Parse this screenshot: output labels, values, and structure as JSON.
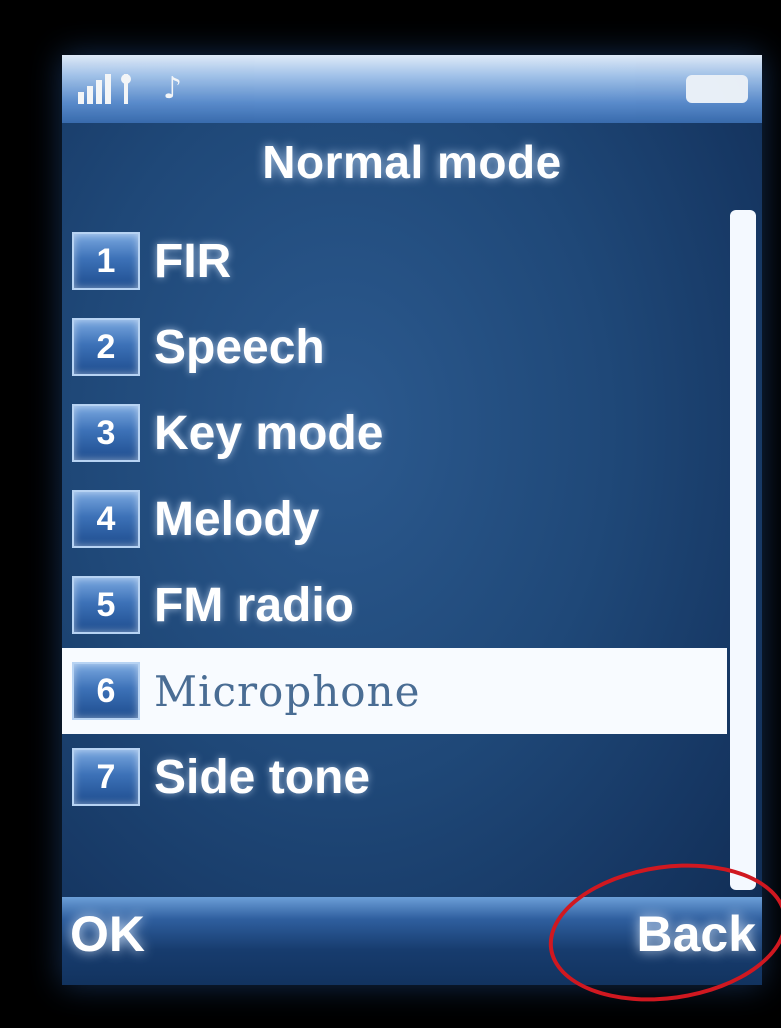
{
  "status": {
    "icons": [
      "signal-icon",
      "antenna-icon",
      "music-note-icon",
      "battery-icon"
    ],
    "note_glyph": "♪"
  },
  "title": "Normal mode",
  "menu": {
    "items": [
      {
        "num": "1",
        "label": "FIR"
      },
      {
        "num": "2",
        "label": "Speech"
      },
      {
        "num": "3",
        "label": "Key mode"
      },
      {
        "num": "4",
        "label": "Melody"
      },
      {
        "num": "5",
        "label": "FM radio"
      },
      {
        "num": "6",
        "label": "Microphone",
        "selected": true
      },
      {
        "num": "7",
        "label": "Side tone"
      }
    ]
  },
  "softkeys": {
    "left": "OK",
    "right": "Back"
  },
  "annotation": {
    "color": "#d01820",
    "target": "Back"
  },
  "colors": {
    "screen": "#1f4878",
    "selection": "#f8fbff",
    "selected_text": "#4a6d94"
  }
}
